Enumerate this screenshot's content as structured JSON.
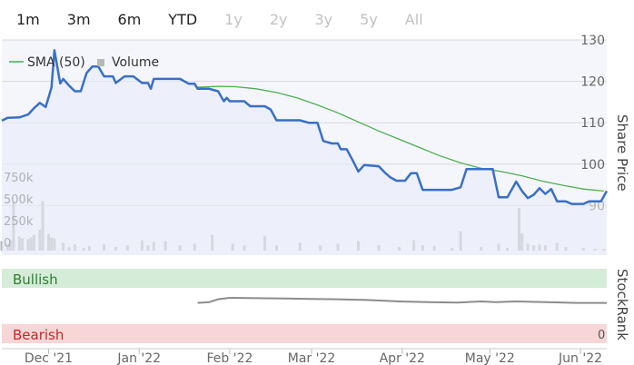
{
  "range_buttons": [
    {
      "label": "1m",
      "enabled": true
    },
    {
      "label": "3m",
      "enabled": true
    },
    {
      "label": "6m",
      "enabled": true
    },
    {
      "label": "YTD",
      "enabled": true
    },
    {
      "label": "1y",
      "enabled": false
    },
    {
      "label": "2y",
      "enabled": false
    },
    {
      "label": "3y",
      "enabled": false
    },
    {
      "label": "5y",
      "enabled": false
    },
    {
      "label": "All",
      "enabled": false
    }
  ],
  "legend": {
    "sma_label": "SMA (50)",
    "volume_label": "Volume"
  },
  "stockrank_title": "StockRank",
  "bands": {
    "bullish": "Bullish",
    "bearish": "Bearish",
    "zero_label": "0"
  },
  "colors": {
    "price": "#3a6fc4",
    "sma": "#4caf50",
    "volume": "#b8b8b8",
    "stockrank": "#8c8c8c",
    "bullish_band": "#d4ecd8",
    "bullish_text": "#2e7d32",
    "bearish_band": "#f6d6d6",
    "bearish_text": "#c62828",
    "plot_bg": "#f4f6fc"
  },
  "chart_data": {
    "type": "line",
    "x_axis": {
      "type": "date",
      "min": "2021-11-15",
      "max": "2022-06-10",
      "tick_labels": [
        "Dec '21",
        "Jan '22",
        "Feb '22",
        "Mar '22",
        "Apr '22",
        "May '22",
        "Jun '22"
      ],
      "tick_dates": [
        "2021-12-01",
        "2022-01-01",
        "2022-02-01",
        "2022-03-01",
        "2022-04-01",
        "2022-05-01",
        "2022-06-01"
      ]
    },
    "y_axis": {
      "title": "Share Price",
      "min": 80,
      "max": 130,
      "ticks": [
        90,
        100,
        110,
        120,
        130
      ],
      "tick_labels": [
        "90",
        "100",
        "110",
        "120",
        "130"
      ],
      "grid": true
    },
    "volume_axis": {
      "min": 0,
      "max": 1500000,
      "ticks": [
        0,
        250000,
        500000,
        750000
      ],
      "tick_labels": [
        "0",
        "250k",
        "500k",
        "750k"
      ]
    },
    "legend_position": "top-left",
    "series": [
      {
        "name": "SMA (50)",
        "kind": "line",
        "points": [
          [
            "2022-01-21",
            118.6
          ],
          [
            "2022-01-28",
            118.8
          ],
          [
            "2022-02-03",
            118.7
          ],
          [
            "2022-02-10",
            118.2
          ],
          [
            "2022-02-17",
            117.3
          ],
          [
            "2022-02-24",
            116.0
          ],
          [
            "2022-03-03",
            114.3
          ],
          [
            "2022-03-10",
            112.4
          ],
          [
            "2022-03-17",
            110.2
          ],
          [
            "2022-03-24",
            108.0
          ],
          [
            "2022-03-31",
            106.0
          ],
          [
            "2022-04-07",
            104.0
          ],
          [
            "2022-04-14",
            102.0
          ],
          [
            "2022-04-21",
            100.3
          ],
          [
            "2022-04-28",
            99.0
          ],
          [
            "2022-05-05",
            98.2
          ],
          [
            "2022-05-12",
            97.2
          ],
          [
            "2022-05-19",
            95.9
          ],
          [
            "2022-05-26",
            94.9
          ],
          [
            "2022-06-02",
            94.0
          ],
          [
            "2022-06-09",
            93.5
          ]
        ]
      },
      {
        "name": "Price",
        "kind": "line",
        "points": [
          [
            "2021-11-15",
            110.5
          ],
          [
            "2021-11-17",
            111.2
          ],
          [
            "2021-11-21",
            111.3
          ],
          [
            "2021-11-24",
            112.0
          ],
          [
            "2021-11-26",
            113.5
          ],
          [
            "2021-11-28",
            114.8
          ],
          [
            "2021-11-30",
            113.8
          ],
          [
            "2021-12-02",
            118.5
          ],
          [
            "2021-12-03",
            127.5
          ],
          [
            "2021-12-05",
            119.5
          ],
          [
            "2021-12-06",
            120.6
          ],
          [
            "2021-12-08",
            119.0
          ],
          [
            "2021-12-10",
            117.6
          ],
          [
            "2021-12-12",
            117.6
          ],
          [
            "2021-12-14",
            122.0
          ],
          [
            "2021-12-16",
            123.6
          ],
          [
            "2021-12-18",
            123.6
          ],
          [
            "2021-12-20",
            121.2
          ],
          [
            "2021-12-23",
            121.2
          ],
          [
            "2021-12-24",
            119.6
          ],
          [
            "2021-12-27",
            121.2
          ],
          [
            "2021-12-30",
            121.2
          ],
          [
            "2022-01-02",
            119.6
          ],
          [
            "2022-01-04",
            119.6
          ],
          [
            "2022-01-05",
            118.2
          ],
          [
            "2022-01-06",
            120.6
          ],
          [
            "2022-01-10",
            120.6
          ],
          [
            "2022-01-15",
            120.6
          ],
          [
            "2022-01-18",
            119.4
          ],
          [
            "2022-01-20",
            119.4
          ],
          [
            "2022-01-21",
            118.2
          ],
          [
            "2022-01-25",
            118.2
          ],
          [
            "2022-01-28",
            117.6
          ],
          [
            "2022-01-30",
            115.2
          ],
          [
            "2022-01-31",
            116.0
          ],
          [
            "2022-02-01",
            115.2
          ],
          [
            "2022-02-06",
            115.2
          ],
          [
            "2022-02-08",
            114.0
          ],
          [
            "2022-02-13",
            114.0
          ],
          [
            "2022-02-15",
            113.2
          ],
          [
            "2022-02-17",
            110.6
          ],
          [
            "2022-02-25",
            110.6
          ],
          [
            "2022-02-28",
            110.0
          ],
          [
            "2022-03-03",
            110.0
          ],
          [
            "2022-03-05",
            105.6
          ],
          [
            "2022-03-08",
            105.0
          ],
          [
            "2022-03-10",
            105.0
          ],
          [
            "2022-03-11",
            103.6
          ],
          [
            "2022-03-13",
            103.6
          ],
          [
            "2022-03-15",
            101.0
          ],
          [
            "2022-03-17",
            98.2
          ],
          [
            "2022-03-19",
            99.8
          ],
          [
            "2022-03-24",
            99.5
          ],
          [
            "2022-03-26",
            98.0
          ],
          [
            "2022-03-28",
            96.8
          ],
          [
            "2022-03-30",
            96.0
          ],
          [
            "2022-04-02",
            96.0
          ],
          [
            "2022-04-04",
            97.8
          ],
          [
            "2022-04-06",
            97.8
          ],
          [
            "2022-04-08",
            93.8
          ],
          [
            "2022-04-18",
            93.8
          ],
          [
            "2022-04-21",
            94.4
          ],
          [
            "2022-04-23",
            98.8
          ],
          [
            "2022-05-02",
            98.8
          ],
          [
            "2022-05-04",
            92.0
          ],
          [
            "2022-05-07",
            92.0
          ],
          [
            "2022-05-10",
            95.8
          ],
          [
            "2022-05-12",
            93.5
          ],
          [
            "2022-05-14",
            91.8
          ],
          [
            "2022-05-16",
            92.6
          ],
          [
            "2022-05-18",
            94.2
          ],
          [
            "2022-05-20",
            92.8
          ],
          [
            "2022-05-22",
            94.0
          ],
          [
            "2022-05-24",
            91.0
          ],
          [
            "2022-05-27",
            91.0
          ],
          [
            "2022-05-29",
            90.4
          ],
          [
            "2022-06-02",
            90.4
          ],
          [
            "2022-06-04",
            91.0
          ],
          [
            "2022-06-08",
            91.0
          ],
          [
            "2022-06-10",
            93.5
          ]
        ]
      },
      {
        "name": "Volume",
        "kind": "bar",
        "points": [
          [
            "2021-11-15",
            110000
          ],
          [
            "2021-11-17",
            80000
          ],
          [
            "2021-11-18",
            120000
          ],
          [
            "2021-11-19",
            560000
          ],
          [
            "2021-11-21",
            160000
          ],
          [
            "2021-11-22",
            140000
          ],
          [
            "2021-11-24",
            130000
          ],
          [
            "2021-11-25",
            150000
          ],
          [
            "2021-11-26",
            180000
          ],
          [
            "2021-11-28",
            240000
          ],
          [
            "2021-11-29",
            570000
          ],
          [
            "2021-12-01",
            190000
          ],
          [
            "2021-12-02",
            150000
          ],
          [
            "2021-12-03",
            140000
          ],
          [
            "2021-12-06",
            90000
          ],
          [
            "2021-12-08",
            40000
          ],
          [
            "2021-12-10",
            70000
          ],
          [
            "2021-12-13",
            30000
          ],
          [
            "2021-12-15",
            50000
          ],
          [
            "2021-12-20",
            70000
          ],
          [
            "2021-12-24",
            40000
          ],
          [
            "2021-12-28",
            60000
          ],
          [
            "2022-01-02",
            120000
          ],
          [
            "2022-01-04",
            60000
          ],
          [
            "2022-01-06",
            100000
          ],
          [
            "2022-01-10",
            110000
          ],
          [
            "2022-01-15",
            60000
          ],
          [
            "2022-01-20",
            80000
          ],
          [
            "2022-01-26",
            180000
          ],
          [
            "2022-02-02",
            80000
          ],
          [
            "2022-02-06",
            60000
          ],
          [
            "2022-02-13",
            170000
          ],
          [
            "2022-02-17",
            60000
          ],
          [
            "2022-02-25",
            90000
          ],
          [
            "2022-03-04",
            60000
          ],
          [
            "2022-03-10",
            80000
          ],
          [
            "2022-03-17",
            110000
          ],
          [
            "2022-03-24",
            60000
          ],
          [
            "2022-03-31",
            40000
          ],
          [
            "2022-04-05",
            120000
          ],
          [
            "2022-04-08",
            60000
          ],
          [
            "2022-04-12",
            50000
          ],
          [
            "2022-04-18",
            30000
          ],
          [
            "2022-04-21",
            220000
          ],
          [
            "2022-04-28",
            40000
          ],
          [
            "2022-05-04",
            80000
          ],
          [
            "2022-05-07",
            30000
          ],
          [
            "2022-05-11",
            490000
          ],
          [
            "2022-05-12",
            200000
          ],
          [
            "2022-05-14",
            80000
          ],
          [
            "2022-05-16",
            60000
          ],
          [
            "2022-05-18",
            70000
          ],
          [
            "2022-05-20",
            60000
          ],
          [
            "2022-05-24",
            90000
          ],
          [
            "2022-05-27",
            40000
          ],
          [
            "2022-06-02",
            30000
          ],
          [
            "2022-06-06",
            20000
          ],
          [
            "2022-06-09",
            20000
          ]
        ]
      },
      {
        "name": "StockRank",
        "kind": "line",
        "points": [
          [
            "2022-01-21",
            0.56
          ],
          [
            "2022-01-25",
            0.58
          ],
          [
            "2022-01-28",
            0.66
          ],
          [
            "2022-02-01",
            0.7
          ],
          [
            "2022-02-10",
            0.69
          ],
          [
            "2022-02-20",
            0.68
          ],
          [
            "2022-03-01",
            0.67
          ],
          [
            "2022-03-10",
            0.66
          ],
          [
            "2022-03-20",
            0.64
          ],
          [
            "2022-03-31",
            0.6
          ],
          [
            "2022-04-10",
            0.58
          ],
          [
            "2022-04-20",
            0.57
          ],
          [
            "2022-04-28",
            0.6
          ],
          [
            "2022-05-03",
            0.58
          ],
          [
            "2022-05-10",
            0.6
          ],
          [
            "2022-05-20",
            0.58
          ],
          [
            "2022-05-31",
            0.56
          ],
          [
            "2022-06-10",
            0.56
          ]
        ]
      }
    ]
  }
}
